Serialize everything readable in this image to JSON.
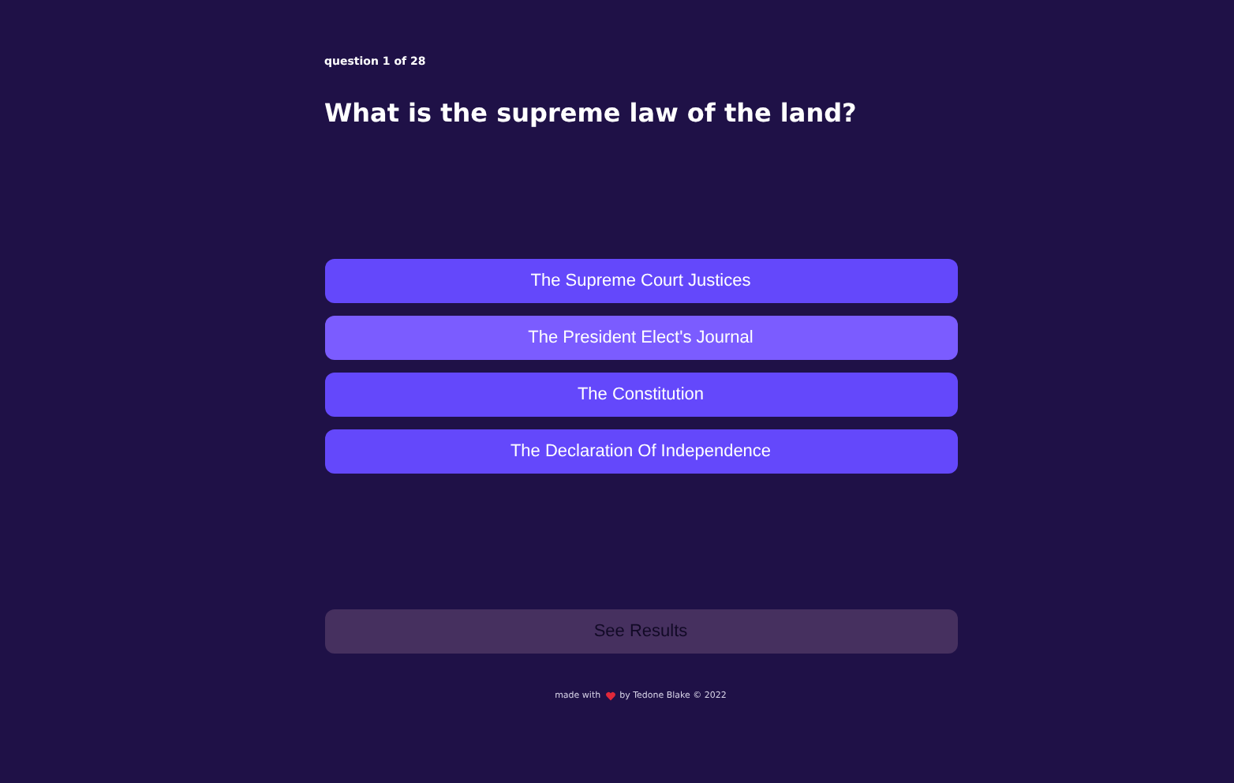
{
  "progress": "question 1 of 28",
  "question": "What is the supreme law of the land?",
  "options": [
    {
      "label": "The Supreme Court Justices",
      "hovered": false
    },
    {
      "label": "The President Elect's Journal",
      "hovered": true
    },
    {
      "label": "The Constitution",
      "hovered": false
    },
    {
      "label": "The Declaration Of Independence",
      "hovered": false
    }
  ],
  "results_button": {
    "label": "See Results",
    "disabled": true
  },
  "footer": {
    "before": "made with",
    "after": "by Tedone Blake © 2022"
  }
}
